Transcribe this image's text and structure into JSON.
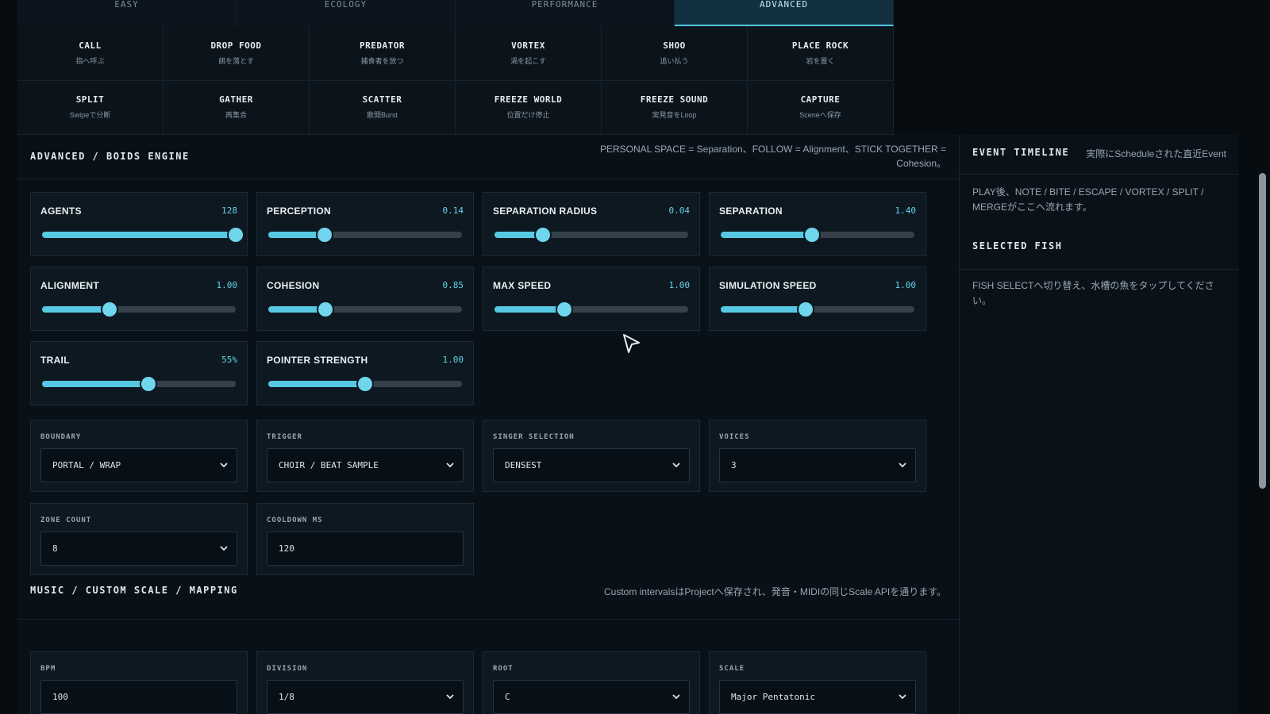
{
  "tabs": [
    {
      "label": "EASY"
    },
    {
      "label": "ECOLOGY"
    },
    {
      "label": "PERFORMANCE"
    },
    {
      "label": "ADVANCED"
    }
  ],
  "actions": [
    {
      "title": "CALL",
      "sub": "指へ呼ぶ"
    },
    {
      "title": "DROP FOOD",
      "sub": "餌を落とす"
    },
    {
      "title": "PREDATOR",
      "sub": "捕食者を放つ"
    },
    {
      "title": "VORTEX",
      "sub": "渦を起こす"
    },
    {
      "title": "SHOO",
      "sub": "追い払う"
    },
    {
      "title": "PLACE ROCK",
      "sub": "岩を置く"
    },
    {
      "title": "SPLIT",
      "sub": "Swipeで分断"
    },
    {
      "title": "GATHER",
      "sub": "再集合"
    },
    {
      "title": "SCATTER",
      "sub": "散開Burst"
    },
    {
      "title": "FREEZE WORLD",
      "sub": "位置だけ停止"
    },
    {
      "title": "FREEZE SOUND",
      "sub": "実発音をLoop"
    },
    {
      "title": "CAPTURE",
      "sub": "Sceneへ保存"
    }
  ],
  "boids": {
    "title": "ADVANCED / BOIDS ENGINE",
    "note1": "PERSONAL SPACE = Separation、FOLLOW = Alignment、STICK TOGETHER =",
    "note2": "Cohesion。",
    "sliders": [
      {
        "label": "AGENTS",
        "value": "128",
        "fraction": 1.0
      },
      {
        "label": "PERCEPTION",
        "value": "0.14",
        "fraction": 0.29
      },
      {
        "label": "SEPARATION RADIUS",
        "value": "0.04",
        "fraction": 0.25
      },
      {
        "label": "SEPARATION",
        "value": "1.40",
        "fraction": 0.47
      },
      {
        "label": "ALIGNMENT",
        "value": "1.00",
        "fraction": 0.35
      },
      {
        "label": "COHESION",
        "value": "0.85",
        "fraction": 0.295
      },
      {
        "label": "MAX SPEED",
        "value": "1.00",
        "fraction": 0.36
      },
      {
        "label": "SIMULATION SPEED",
        "value": "1.00",
        "fraction": 0.44
      },
      {
        "label": "TRAIL",
        "value": "55%",
        "fraction": 0.55
      },
      {
        "label": "POINTER STRENGTH",
        "value": "1.00",
        "fraction": 0.5
      }
    ],
    "selects": [
      {
        "label": "BOUNDARY",
        "value": "PORTAL / WRAP"
      },
      {
        "label": "TRIGGER",
        "value": "CHOIR / BEAT SAMPLE"
      },
      {
        "label": "SINGER SELECTION",
        "value": "DENSEST"
      },
      {
        "label": "VOICES",
        "value": "3"
      },
      {
        "label": "ZONE COUNT",
        "value": "8"
      }
    ],
    "cooldown": {
      "label": "COOLDOWN MS",
      "value": "120"
    }
  },
  "music": {
    "title": "MUSIC / CUSTOM SCALE / MAPPING",
    "note": "Custom intervalsはProjectへ保存され、発音・MIDIの同じScale APIを通ります。",
    "bpm": {
      "label": "BPM",
      "value": "100"
    },
    "division": {
      "label": "DIVISION",
      "value": "1/8"
    },
    "root": {
      "label": "ROOT",
      "value": "C"
    },
    "scale": {
      "label": "SCALE",
      "value": "Major Pentatonic"
    }
  },
  "sidebar": {
    "timeline_title": "EVENT TIMELINE",
    "timeline_note": "実際にScheduleされた直近Event",
    "timeline_text": "PLAY後、NOTE / BITE / ESCAPE / VORTEX / SPLIT / MERGEがここへ流れます。",
    "selected_title": "SELECTED FISH",
    "selected_text": "FISH SELECTへ切り替え、水槽の魚をタップしてください。"
  },
  "colors": {
    "accent": "#56c8e2",
    "background": "#070c11",
    "panel": "#0d1820"
  }
}
